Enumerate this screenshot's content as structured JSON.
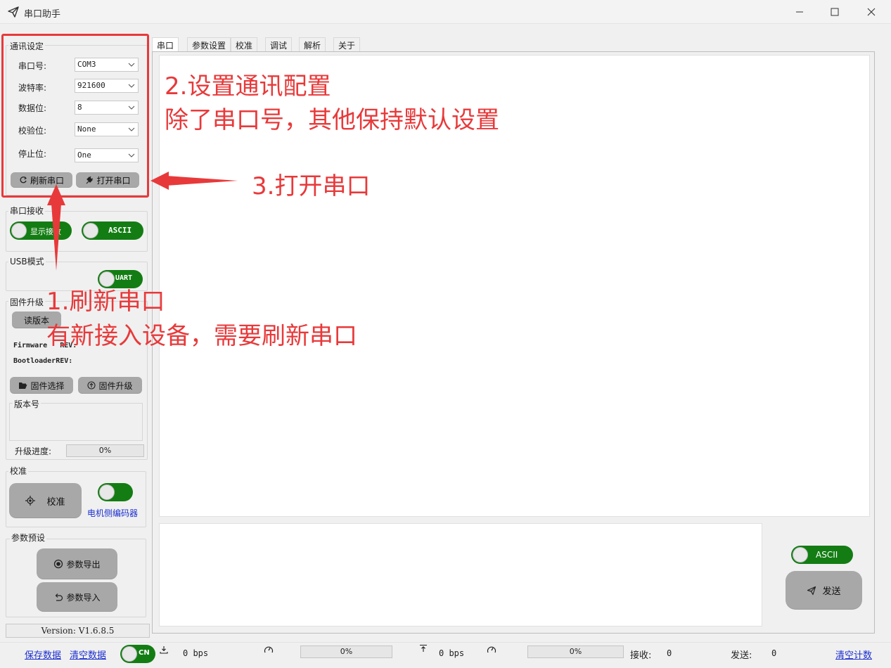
{
  "window": {
    "title": "串口助手"
  },
  "tabs": [
    "串口",
    "参数设置",
    "校准",
    "调试",
    "解析",
    "关于"
  ],
  "comm": {
    "group_label": "通讯设定",
    "port_label": "串口号:",
    "port_value": "COM3",
    "baud_label": "波特率:",
    "baud_value": "921600",
    "data_label": "数据位:",
    "data_value": "8",
    "parity_label": "校验位:",
    "parity_value": "None",
    "stop_label": "停止位:",
    "stop_value": "One",
    "refresh_button": "刷新串口",
    "open_button": "打开串口"
  },
  "receive": {
    "group_label": "串口接收",
    "display_toggle": "显示接收",
    "ascii_toggle": "ASCII"
  },
  "usb": {
    "group_label": "USB模式",
    "uart_toggle": "UART"
  },
  "firmware": {
    "group_label": "固件升级",
    "read_version_button": "读版本",
    "firmware_rev_label": "Firmware",
    "firmware_rev_suffix": "REV:",
    "bootloader_rev_label": "Bootloader",
    "bootloader_rev_suffix": "REV:",
    "select_button": "固件选择",
    "upgrade_button": "固件升级",
    "version_group_label": "版本号",
    "progress_label": "升级进度:",
    "progress_text": "0%",
    "progress_value": 0
  },
  "calibration": {
    "group_label": "校准",
    "calibrate_button": "校准",
    "encoder_label": "电机侧编码器"
  },
  "params": {
    "group_label": "参数预设",
    "export_button": "参数导出",
    "import_button": "参数导入"
  },
  "version": "Version: V1.6.8.5",
  "send": {
    "ascii_toggle": "ASCII",
    "send_button": "发送"
  },
  "statusbar": {
    "save_data": "保存数据",
    "clear_data": "清空数据",
    "lang_toggle": "CN",
    "rx_rate": "0 bps",
    "rx_progress": "0%",
    "tx_rate": "0 bps",
    "tx_progress": "0%",
    "rx_label": "接收:",
    "rx_count": "0",
    "tx_label": "发送:",
    "tx_count": "0",
    "clear_count": "清空计数"
  },
  "annotations": {
    "step2_line1": "2.设置通讯配置",
    "step2_line2": "除了串口号，其他保持默认设置",
    "step3": "3.打开串口",
    "step1_line1": "1.刷新串口",
    "step1_line2": "有新接入设备，需要刷新串口"
  },
  "colors": {
    "toggle_green": "#137d13",
    "annotation_red": "#e8393a",
    "button_gray": "#a8a8a8",
    "link_blue": "#1c2fd0"
  }
}
